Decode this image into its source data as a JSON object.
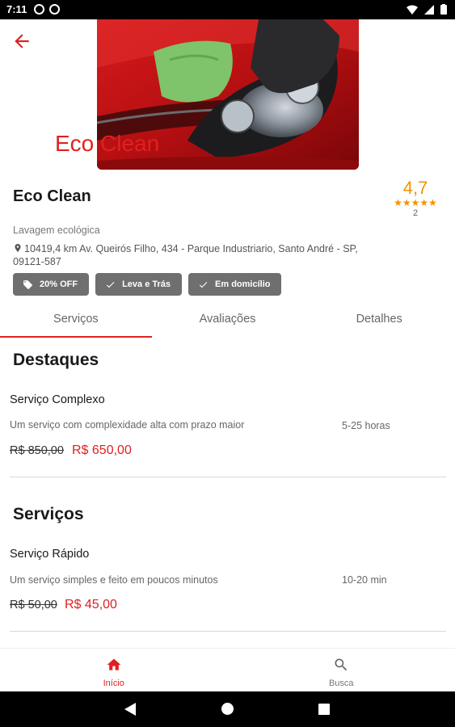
{
  "status_bar": {
    "time": "7:11"
  },
  "header": {
    "hero_title": "Eco Clean"
  },
  "shop": {
    "name": "Eco Clean",
    "rating": "4,7",
    "stars": "★★★★★",
    "rating_count": "2",
    "category": "Lavagem ecológica",
    "address": "10419,4 km Av. Queirós Filho, 434 - Parque Industriario, Santo André - SP, 09121-587"
  },
  "tags": [
    {
      "label": "20% OFF",
      "icon": "tag-icon"
    },
    {
      "label": "Leva e Trás",
      "icon": "check-icon"
    },
    {
      "label": "Em domicílio",
      "icon": "check-icon"
    }
  ],
  "tabs": [
    {
      "label": "Serviços",
      "active": true
    },
    {
      "label": "Avaliações",
      "active": false
    },
    {
      "label": "Detalhes",
      "active": false
    }
  ],
  "sections": [
    {
      "title": "Destaques",
      "service": {
        "name": "Serviço Complexo",
        "description": "Um serviço com complexidade alta com prazo maior",
        "duration": "5-25 horas",
        "old_price": "R$ 850,00",
        "new_price": "R$ 650,00"
      }
    },
    {
      "title": "Serviços",
      "service": {
        "name": "Serviço Rápido",
        "description": "Um serviço simples e feito em poucos minutos",
        "duration": "10-20 min",
        "old_price": "R$ 50,00",
        "new_price": "R$ 45,00"
      }
    }
  ],
  "bottom_nav": [
    {
      "label": "Início",
      "icon": "home-icon",
      "active": true
    },
    {
      "label": "Busca",
      "icon": "search-icon",
      "active": false
    }
  ],
  "colors": {
    "accent": "#e02020",
    "rating": "#f39200",
    "tag_bg": "#6f6f6f"
  }
}
